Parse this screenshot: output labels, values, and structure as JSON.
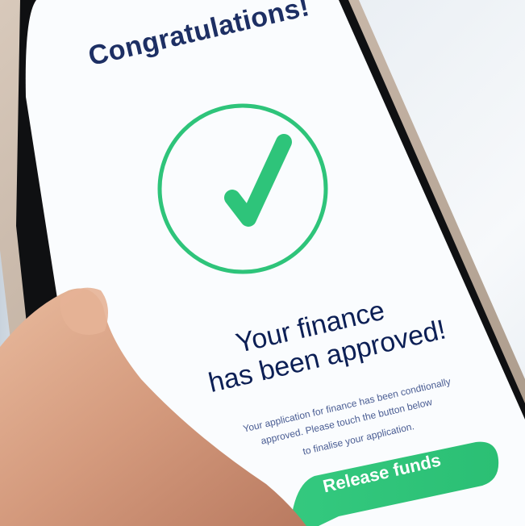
{
  "screen": {
    "title": "Congratulations!",
    "headline_line1": "Your finance",
    "headline_line2": "has been approved!",
    "body_line1": "Your application for finance has been condtionally",
    "body_line2": "approved. Please touch the button below",
    "body_line3": "to finalise your application.",
    "release_button_label": "Release funds"
  },
  "icons": {
    "status": "checkmark-icon"
  },
  "colors": {
    "accent_green": "#2ec47a",
    "title_navy": "#1d2f64",
    "headline_navy": "#0c1f55",
    "body_blue": "#4a5d93",
    "screen_white": "#fafcfe",
    "phone_frame": "#c9b8a8",
    "bezel_black": "#0f1012",
    "skin": "#d9a88c"
  }
}
